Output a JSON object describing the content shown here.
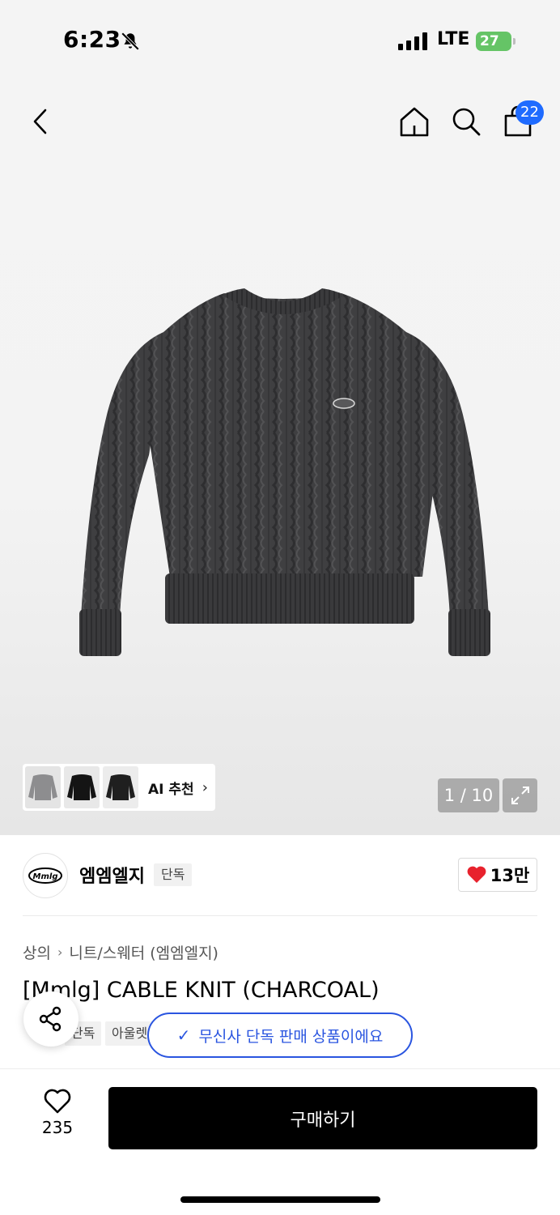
{
  "status_bar": {
    "time": "6:23",
    "network": "LTE",
    "battery": "27"
  },
  "nav": {
    "cart_count": "22"
  },
  "gallery": {
    "ai_recommend_label": "AI 추천",
    "page_counter": "1 / 10"
  },
  "brand": {
    "name": "엠엠엘지",
    "badge": "단독",
    "logo_text": "Mmlg",
    "like_count": "13만"
  },
  "product": {
    "breadcrumb": [
      "상의",
      "니트/스웨터 (엠엠엘지)"
    ],
    "title": "[Mmlg] CABLE KNIT (CHARCOAL)",
    "tags": [
      "단독",
      "아울렛"
    ]
  },
  "toast": {
    "message": "무신사 단독 판매 상품이에요"
  },
  "bottom": {
    "wish_count": "235",
    "buy_label": "구매하기"
  },
  "colors": {
    "accent_blue": "#2a55e0",
    "badge_blue": "#1f6bff",
    "heart_red": "#e8222d",
    "battery_green": "#65c466"
  }
}
